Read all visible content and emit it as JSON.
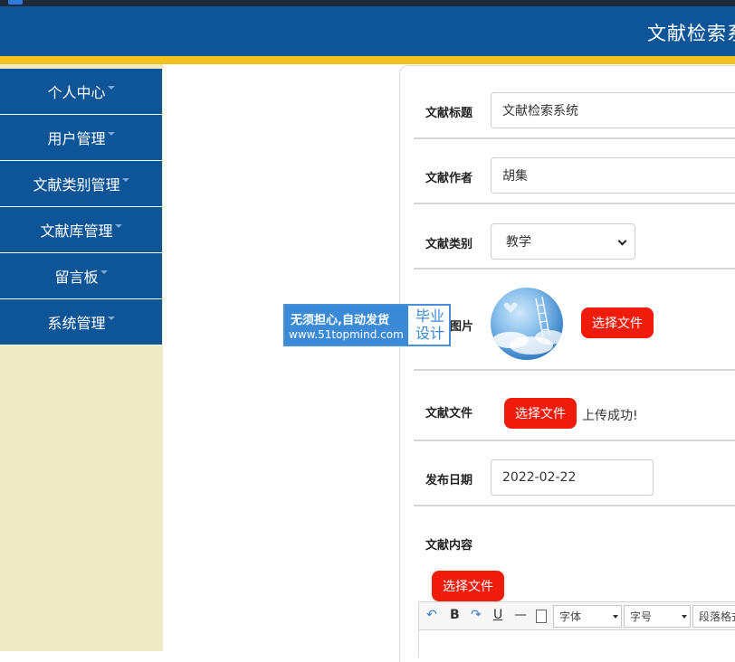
{
  "header": {
    "title": "文献检索系统"
  },
  "sidebar": {
    "items": [
      {
        "label": "个人中心"
      },
      {
        "label": "用户管理"
      },
      {
        "label": "文献类别管理"
      },
      {
        "label": "文献库管理"
      },
      {
        "label": "留言板"
      },
      {
        "label": "系统管理"
      }
    ]
  },
  "form": {
    "title_label": "文献标题",
    "title_value": "文献检索系统",
    "author_label": "文献作者",
    "author_value": "胡集",
    "category_label": "文献类别",
    "category_value": "教学",
    "image_label": "图片",
    "image_button": "选择文件",
    "file_label": "文献文件",
    "file_button": "选择文件",
    "file_status": "上传成功!",
    "date_label": "发布日期",
    "date_value": "2022-02-22",
    "content_label": "文献内容",
    "content_button": "选择文件"
  },
  "editor": {
    "font_placeholder": "字体",
    "size_placeholder": "字号",
    "paragraph_placeholder": "段落格式"
  },
  "watermark": {
    "line1": "无须担心,自动发货",
    "line2": "www.51topmind.com",
    "right": "毕业设计"
  },
  "colors": {
    "header": "#0d5596",
    "accent_bar": "#f5c11b",
    "sidebar_bg": "#efeac4",
    "button": "#ef1c0b"
  }
}
